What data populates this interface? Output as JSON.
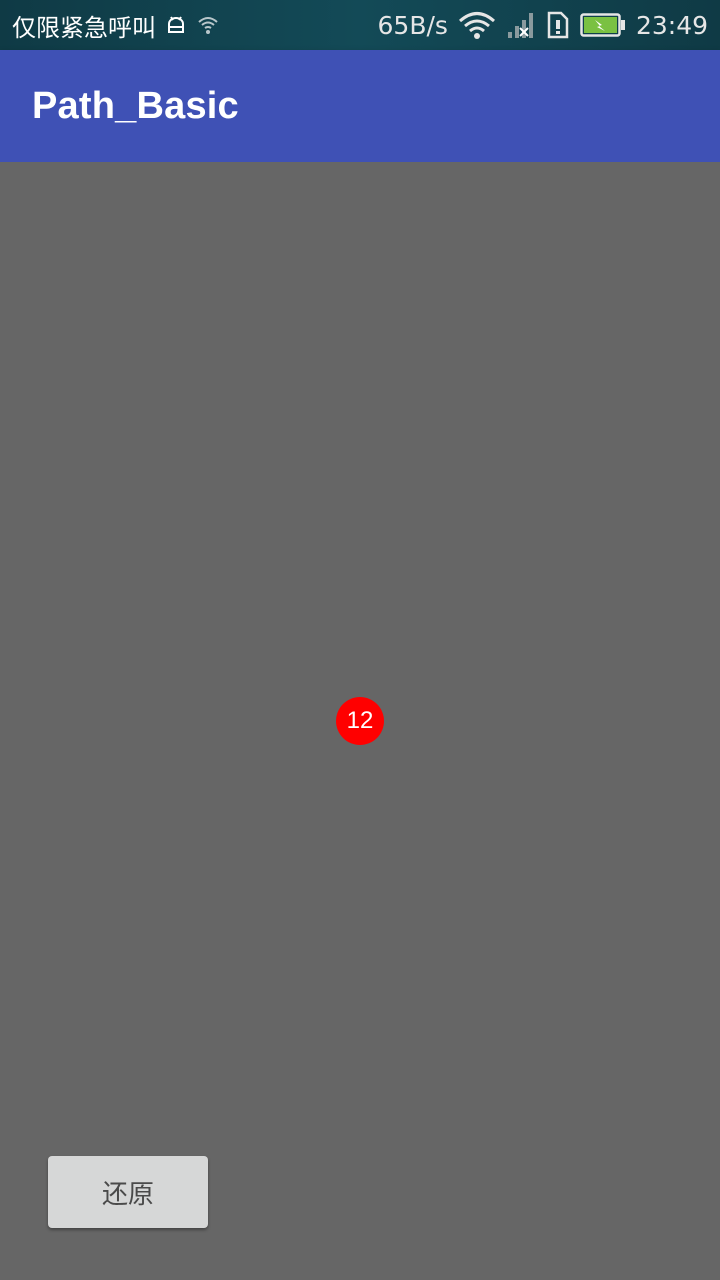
{
  "status_bar": {
    "carrier_text": "仅限紧急呼叫",
    "network_speed": "65B/s",
    "time": "23:49",
    "icons": [
      "android-icon",
      "wifi-small-icon",
      "wifi-icon",
      "signal-icon",
      "sim-alert-icon",
      "battery-icon"
    ]
  },
  "app_bar": {
    "title": "Path_Basic",
    "color": "#3f51b5"
  },
  "canvas": {
    "background": "#666666",
    "badge_label": "12",
    "badge_color": "#ff0000"
  },
  "restore_button": {
    "label": "还原"
  }
}
